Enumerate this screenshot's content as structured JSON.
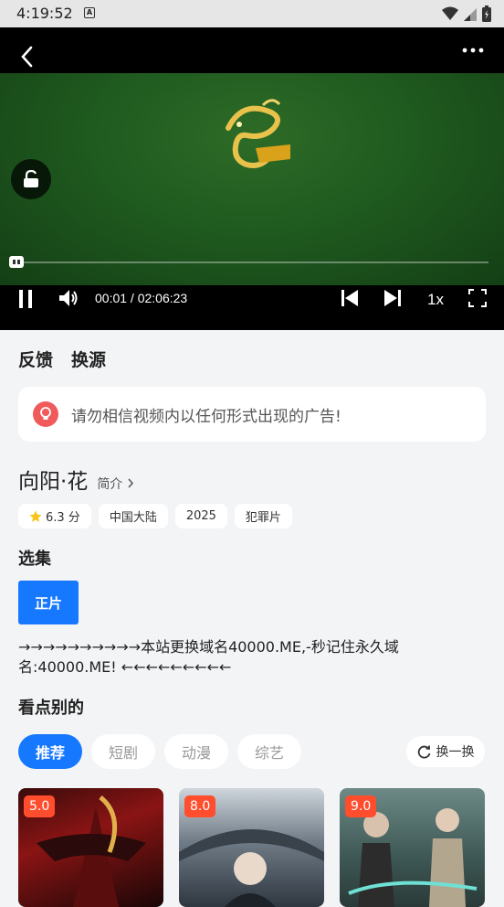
{
  "status_bar": {
    "time": "4:19:52"
  },
  "player": {
    "current_time": "00:01",
    "total_time": "02:06:23",
    "separator": " / ",
    "speed": "1x",
    "progress": 0.0
  },
  "actions": {
    "feedback": "反馈",
    "switch_source": "换源"
  },
  "notice": {
    "text": "请勿相信视频内以任何形式出现的广告!"
  },
  "movie": {
    "title": "向阳·花",
    "intro_label": "简介",
    "tags": [
      {
        "label": "6.3 分",
        "icon": "star-icon"
      },
      {
        "label": "中国大陆"
      },
      {
        "label": "2025"
      },
      {
        "label": "犯罪片"
      }
    ]
  },
  "episodes": {
    "heading": "选集",
    "items": [
      "正片"
    ]
  },
  "domain_notice": "→→→→→→→→→→本站更换域名40000.ME,-秒记住永久域名:40000.ME! ←←←←←←←←←",
  "recommend": {
    "heading": "看点别的",
    "tabs": [
      "推荐",
      "短剧",
      "动漫",
      "综艺"
    ],
    "active_tab": 0,
    "refresh_label": "换一换",
    "cards": [
      {
        "score": "5.0"
      },
      {
        "score": "8.0"
      },
      {
        "score": "9.0"
      }
    ]
  },
  "colors": {
    "accent": "#1677ff",
    "score_badge": "#ff4d2e",
    "notice_icon": "#f15a5a"
  }
}
